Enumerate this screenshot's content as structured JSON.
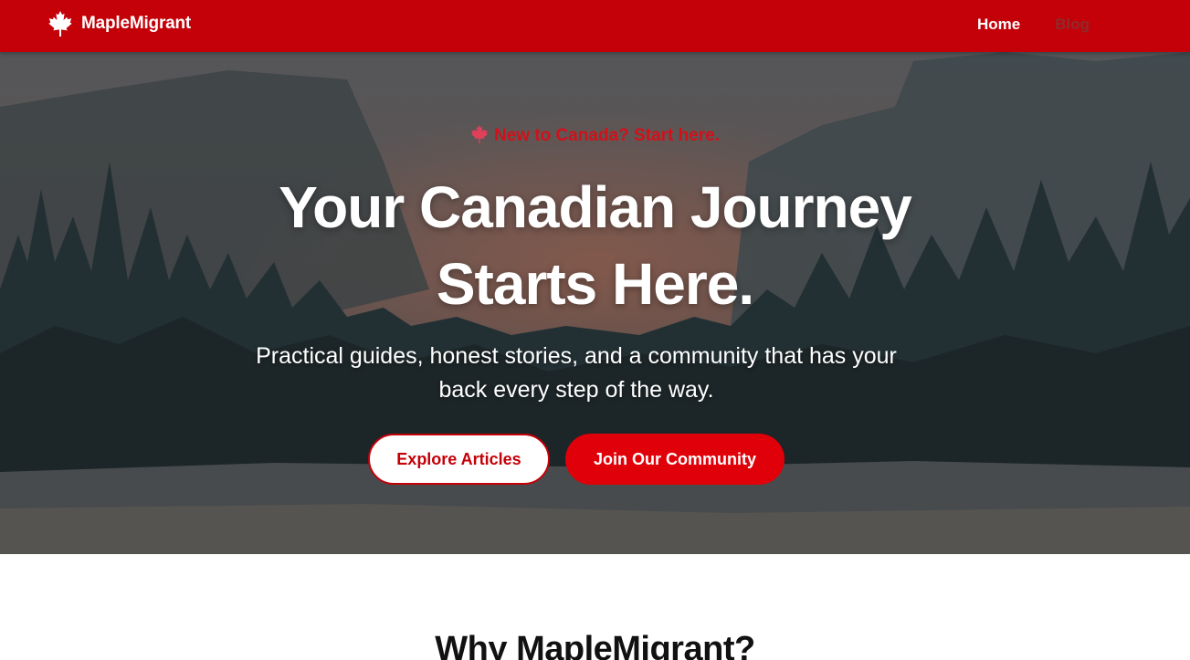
{
  "nav": {
    "brand": "MapleMigrant",
    "links": [
      {
        "label": "Home",
        "active": true
      },
      {
        "label": "Blog",
        "active": false
      }
    ]
  },
  "hero": {
    "kicker": "New to Canada? Start here.",
    "headline_line1": "Your Canadian Journey",
    "headline_line2": "Starts Here.",
    "subhead_line1": "Practical guides, honest stories, and a community that has your",
    "subhead_line2": "back every step of the way.",
    "primary_button": "Explore Articles",
    "secondary_button": "Join Our Community"
  },
  "section": {
    "title": "Why MapleMigrant?"
  },
  "colors": {
    "brand_red": "#c40008",
    "button_red": "#e00009",
    "white": "#ffffff"
  },
  "icons": {
    "logo": "maple-leaf-icon",
    "kicker": "maple-leaf-icon"
  }
}
